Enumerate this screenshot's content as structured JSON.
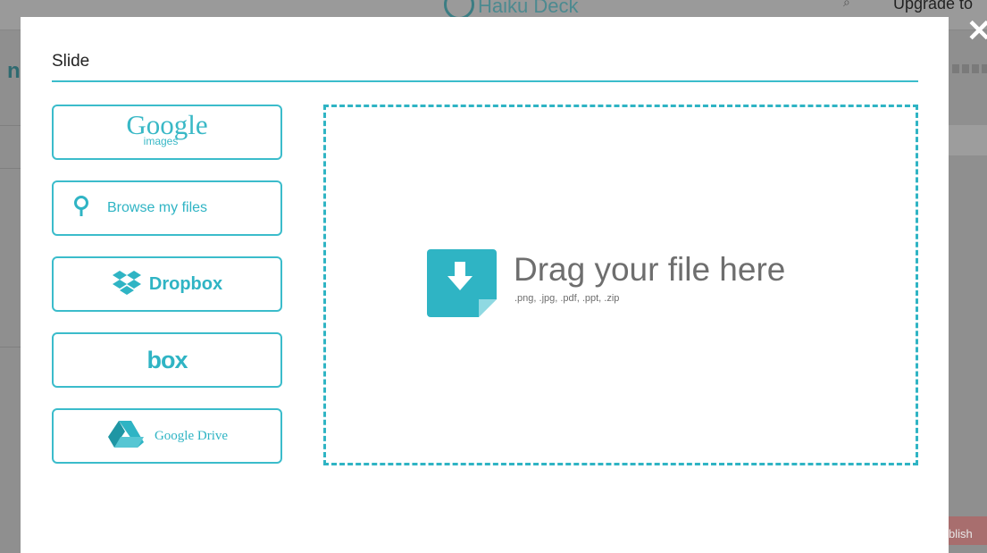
{
  "background": {
    "logo_text": "Haiku Deck",
    "upgrade_label": "Upgrade to",
    "left_fragment": "n",
    "publish_label": "blish"
  },
  "modal": {
    "title": "Slide",
    "close_label": "✕",
    "sources": {
      "google_images": {
        "word": "Google",
        "sub": "images"
      },
      "browse": {
        "label": "Browse my files"
      },
      "dropbox": {
        "label": "Dropbox"
      },
      "box": {
        "label": "box"
      },
      "google_drive": {
        "label": "Google Drive"
      }
    },
    "dropzone": {
      "heading": "Drag your file here",
      "types": ".png, .jpg, .pdf, .ppt, .zip"
    }
  },
  "colors": {
    "accent": "#2fb4c4",
    "overlay": "#8f8f8f",
    "text_gray": "#6e6e6e"
  },
  "icons": [
    "search-icon",
    "dropbox-icon",
    "google-drive-icon",
    "download-file-icon",
    "close-icon"
  ]
}
